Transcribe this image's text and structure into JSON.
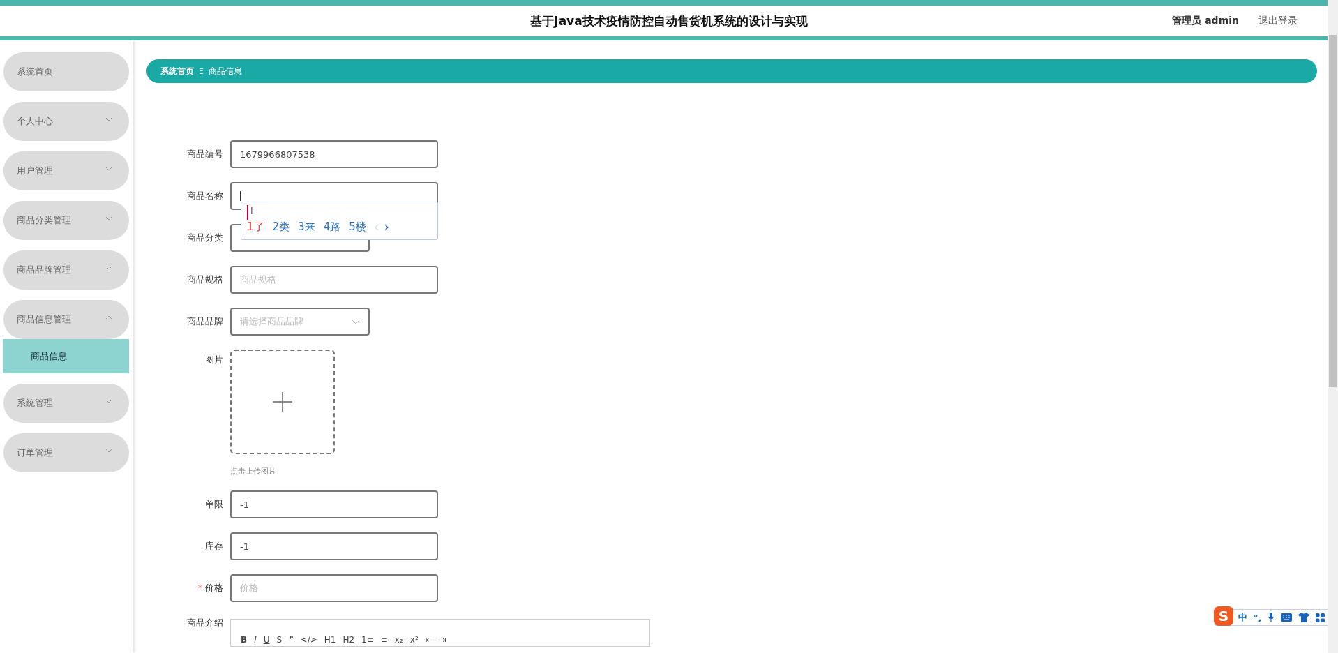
{
  "header": {
    "title": "基于Java技术疫情防控自动售货机系统的设计与实现",
    "user": "管理员 admin",
    "logout": "退出登录"
  },
  "sidebar": {
    "items": [
      {
        "label": "系统首页"
      },
      {
        "label": "个人中心",
        "expanded": false
      },
      {
        "label": "用户管理",
        "expanded": false
      },
      {
        "label": "商品分类管理",
        "expanded": false
      },
      {
        "label": "商品品牌管理",
        "expanded": false
      },
      {
        "label": "商品信息管理",
        "expanded": true,
        "children": [
          {
            "label": "商品信息",
            "selected": true
          }
        ]
      },
      {
        "label": "系统管理",
        "expanded": false
      },
      {
        "label": "订单管理",
        "expanded": false
      }
    ]
  },
  "breadcrumb": {
    "items": [
      "系统首页",
      "商品信息"
    ],
    "separator": "Ξ"
  },
  "form": {
    "fields": [
      {
        "kind": "input",
        "label": "商品编号",
        "value": "1679966807538"
      },
      {
        "kind": "input",
        "label": "商品名称",
        "ime": {
          "composition": "l",
          "candidates": [
            "1了",
            "2类",
            "3来",
            "4路",
            "5楼"
          ]
        }
      },
      {
        "kind": "select",
        "label": "商品分类"
      },
      {
        "kind": "input",
        "label": "商品规格",
        "placeholder": "商品规格"
      },
      {
        "kind": "select",
        "label": "商品品牌",
        "placeholder": "请选择商品品牌"
      },
      {
        "kind": "upload",
        "label": "图片",
        "hint": "点击上传图片"
      },
      {
        "kind": "input",
        "label": "单限",
        "value": "-1"
      },
      {
        "kind": "input",
        "label": "库存",
        "value": "-1"
      },
      {
        "kind": "input",
        "label": "价格",
        "placeholder": "价格",
        "required": true,
        "required_mark": "*"
      },
      {
        "kind": "editor",
        "label": "商品介绍",
        "toolbar": [
          "B",
          "I",
          "U",
          "S",
          "❞",
          "</>",
          "H1",
          "H2",
          "1≡",
          "≡",
          "x₂",
          "x²",
          "⇤",
          "⇥"
        ]
      }
    ]
  },
  "ime_toolbar": {
    "logo": "S",
    "mode": "中",
    "punct": "°,"
  }
}
